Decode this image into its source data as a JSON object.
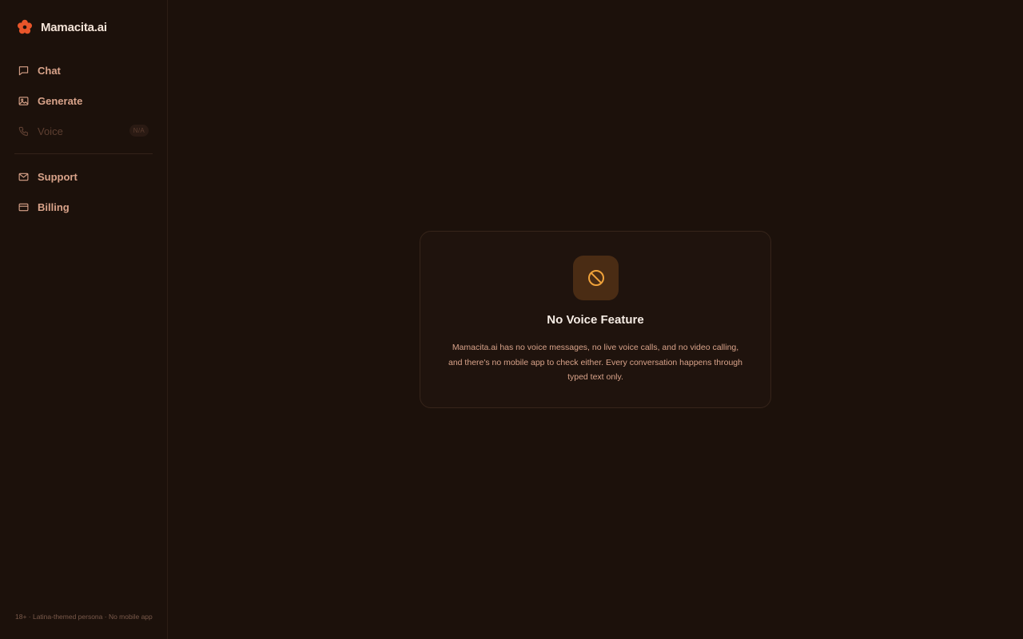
{
  "app": {
    "name": "Mamacita.ai",
    "logo_icon": "flower-icon",
    "accent_color": "#e8552a"
  },
  "sidebar": {
    "items": [
      {
        "label": "Chat",
        "icon": "chat-bubble-icon"
      },
      {
        "label": "Generate",
        "icon": "image-icon"
      },
      {
        "label": "Voice",
        "icon": "phone-icon",
        "badge": "N/A",
        "disabled": true
      },
      {
        "label": "Support",
        "icon": "mail-icon"
      },
      {
        "label": "Billing",
        "icon": "credit-card-icon"
      }
    ],
    "footer": "18+ · Latina-themed persona · No mobile app"
  },
  "notice": {
    "icon": "prohibited-icon",
    "icon_color": "#f0a23a",
    "title": "No Voice Feature",
    "body": "Mamacita.ai has no voice messages, no live voice calls, and no video calling, and there's no mobile app to check either. Every conversation happens through typed text only."
  }
}
